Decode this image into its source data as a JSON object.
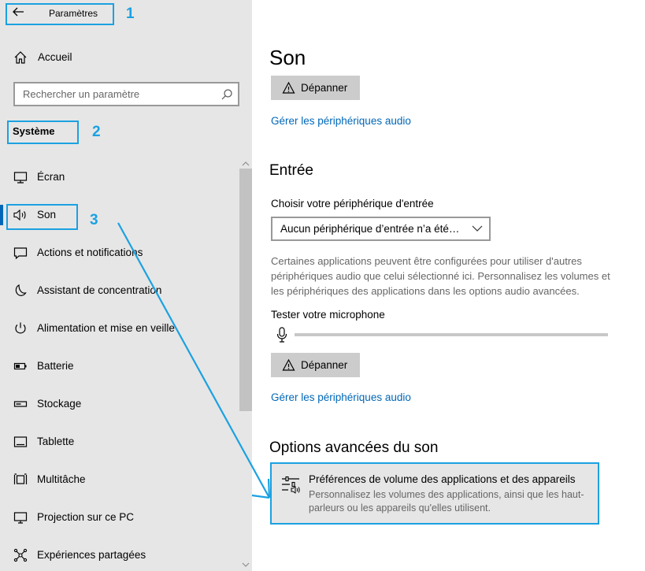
{
  "sidebar": {
    "back_title": "Paramètres",
    "home_label": "Accueil",
    "search_placeholder": "Rechercher un paramètre",
    "section_title": "Système",
    "items": [
      {
        "label": "Écran",
        "icon": "monitor-icon"
      },
      {
        "label": "Son",
        "icon": "speaker-icon"
      },
      {
        "label": "Actions et notifications",
        "icon": "notification-icon"
      },
      {
        "label": "Assistant de concentration",
        "icon": "moon-icon"
      },
      {
        "label": "Alimentation et mise en veille",
        "icon": "power-icon"
      },
      {
        "label": "Batterie",
        "icon": "battery-icon"
      },
      {
        "label": "Stockage",
        "icon": "storage-icon"
      },
      {
        "label": "Tablette",
        "icon": "tablet-icon"
      },
      {
        "label": "Multitâche",
        "icon": "multitask-icon"
      },
      {
        "label": "Projection sur ce PC",
        "icon": "projection-icon"
      },
      {
        "label": "Expériences partagées",
        "icon": "shared-icon"
      }
    ]
  },
  "annotations": {
    "one": "1",
    "two": "2",
    "three": "3"
  },
  "main": {
    "title": "Son",
    "troubleshoot_label": "Dépanner",
    "manage_devices_link": "Gérer les périphériques audio",
    "input_heading": "Entrée",
    "choose_input_label": "Choisir votre périphérique d'entrée",
    "input_device_value": "Aucun périphérique d’entrée n’a été…",
    "input_desc": "Certaines applications peuvent être configurées pour utiliser d'autres périphériques audio que celui sélectionné ici. Personnalisez les volumes et les périphériques des applications dans les options audio avancées.",
    "test_mic_label": "Tester votre microphone",
    "troubleshoot_label_2": "Dépanner",
    "manage_devices_link_2": "Gérer les périphériques audio",
    "advanced_heading": "Options avancées du son",
    "app_volume_title": "Préférences de volume des applications et des appareils",
    "app_volume_desc": "Personnalisez les volumes des applications, ainsi que les haut-parleurs ou les appareils qu'elles utilisent."
  },
  "colors": {
    "accent": "#0067b8",
    "annotation": "#1ba1e2",
    "sidebar_bg": "#e6e6e6"
  }
}
